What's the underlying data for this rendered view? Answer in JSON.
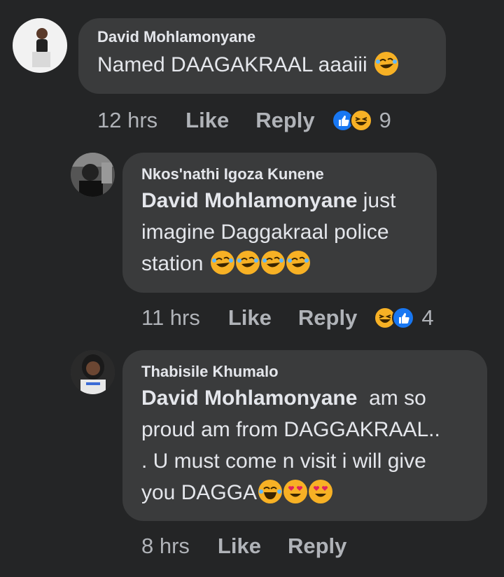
{
  "comments": [
    {
      "author": "David Mohlamonyane",
      "text": "Named DAAGAKRAAL aaaiii",
      "emojis": [
        "rolling-laughing-emoji"
      ],
      "time": "12 hrs",
      "like_label": "Like",
      "reply_label": "Reply",
      "reactions": [
        "like",
        "haha"
      ],
      "reaction_count": "9"
    },
    {
      "author": "Nkos'nathi Igoza Kunene",
      "mention": "David Mohlamonyane",
      "text_line1": " just",
      "text_line2": "imagine Daggakraal police",
      "text_line3": "station",
      "emojis": [
        "rolling-laughing-emoji",
        "rolling-laughing-emoji",
        "rolling-laughing-emoji",
        "rolling-laughing-emoji"
      ],
      "time": "11 hrs",
      "like_label": "Like",
      "reply_label": "Reply",
      "reactions": [
        "haha",
        "like"
      ],
      "reaction_count": "4"
    },
    {
      "author": "Thabisile Khumalo",
      "mention": "David Mohlamonyane",
      "text_line1": "  am so",
      "text_line2": "proud am from DAGGAKRAAL..",
      "text_line3": ". U must come n visit i will give",
      "text_line4": "you DAGGA",
      "emojis": [
        "tears-of-joy-emoji",
        "heart-eyes-emoji",
        "heart-eyes-emoji"
      ],
      "time": "8 hrs",
      "like_label": "Like",
      "reply_label": "Reply"
    }
  ],
  "colors": {
    "background": "#242526",
    "bubble": "#3a3b3c",
    "text": "#e4e6eb",
    "meta": "#b0b3b8",
    "like_blue": "#1877f2",
    "emoji_yellow": "#f7b125"
  }
}
